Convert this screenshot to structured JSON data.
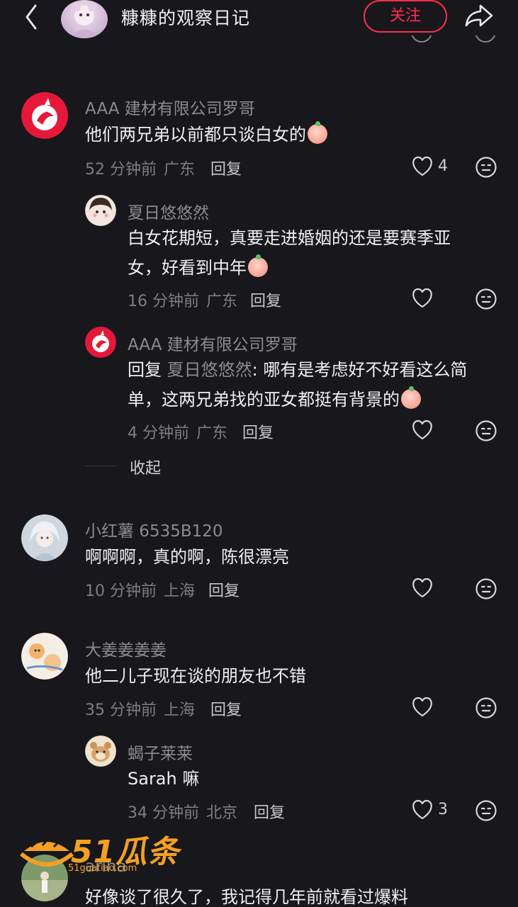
{
  "header": {
    "title": "糠糠的观察日记",
    "follow_label": "关注"
  },
  "comments": [
    {
      "username": "AAA 建材有限公司罗哥",
      "text": "他们两兄弟以前都只谈白女的",
      "time": "52 分钟前",
      "location": "广东",
      "reply_label": "回复",
      "likes": "4",
      "replies": [
        {
          "username": "夏日悠悠然",
          "text": "白女花期短，真要走进婚姻的还是要赛季亚女，好看到中年",
          "time": "16 分钟前",
          "location": "广东",
          "reply_label": "回复",
          "likes": ""
        },
        {
          "username": "AAA 建材有限公司罗哥",
          "prefix": "回复",
          "mention": "夏日悠悠然",
          "text": ": 哪有是考虑好不好看这么简单，这两兄弟找的亚女都挺有背景的",
          "time": "4 分钟前",
          "location": "广东",
          "reply_label": "回复",
          "likes": ""
        }
      ],
      "collapse_label": "收起"
    },
    {
      "username": "小红薯 6535B120",
      "text": "啊啊啊，真的啊，陈很漂亮",
      "time": "10 分钟前",
      "location": "上海",
      "reply_label": "回复",
      "likes": ""
    },
    {
      "username": "大姜姜姜姜",
      "text": "他二儿子现在谈的朋友也不错",
      "time": "35 分钟前",
      "location": "上海",
      "reply_label": "回复",
      "likes": "",
      "replies": [
        {
          "username": "蝎子莱莱",
          "text": "Sarah 嘛",
          "time": "34 分钟前",
          "location": "北京",
          "reply_label": "回复",
          "likes": "3"
        }
      ]
    },
    {
      "username": "arina",
      "text": "好像谈了很久了，我记得几年前就看过爆料"
    }
  ],
  "watermark": {
    "text": "51瓜条",
    "url": "51guatiao.com"
  },
  "colors": {
    "background": "#17171c",
    "accent": "#ff2e4d",
    "muted": "#8c8c8c"
  }
}
